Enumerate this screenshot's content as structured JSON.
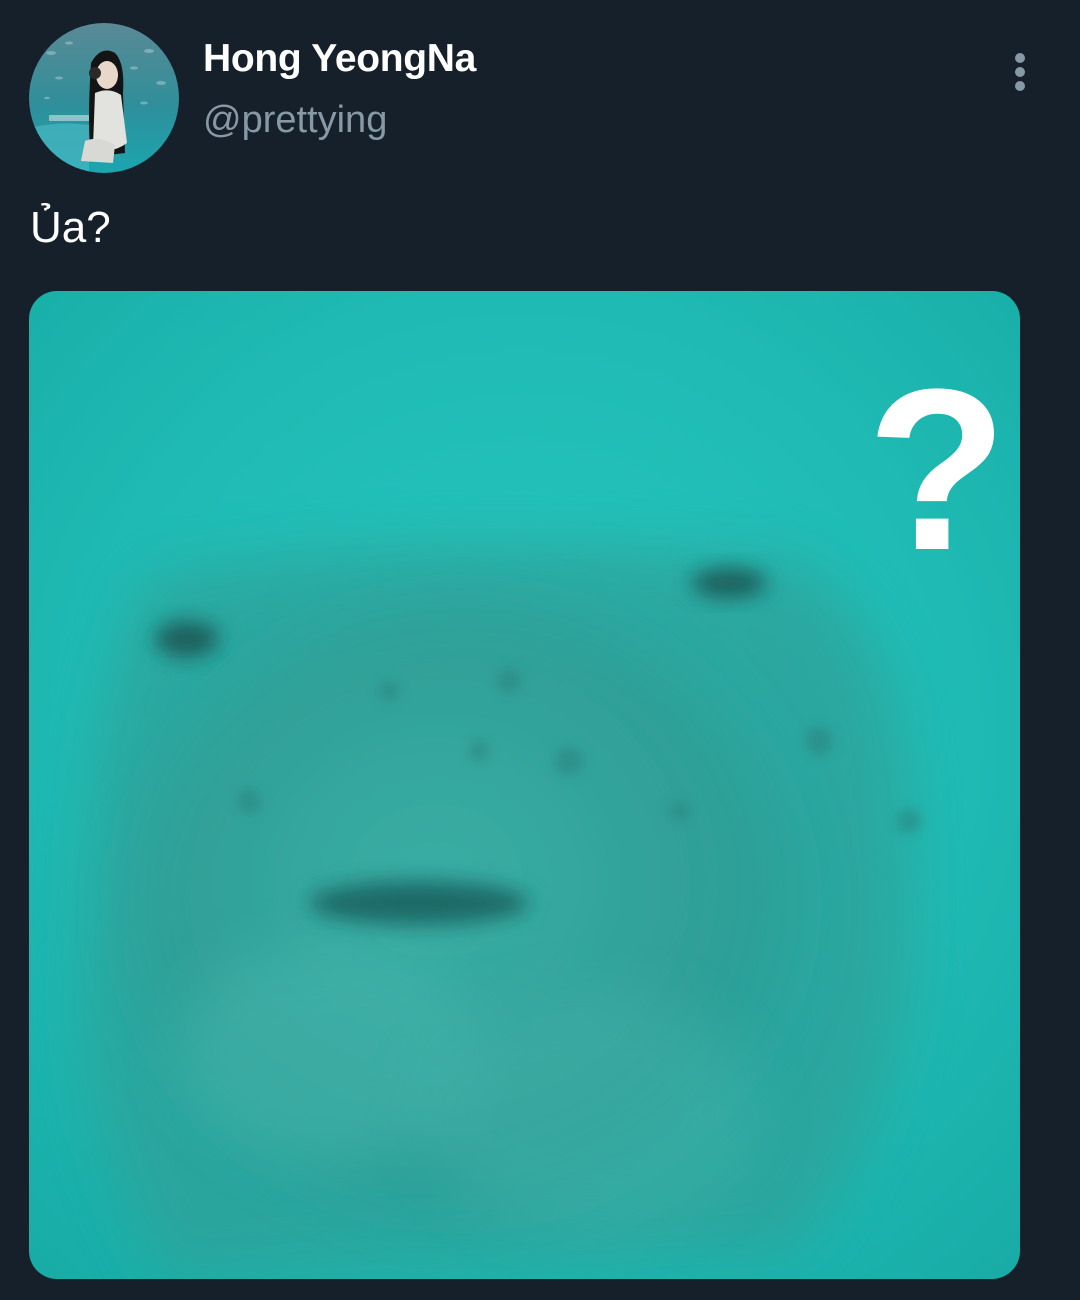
{
  "author": {
    "display_name": "Hong YeongNa",
    "handle": "@prettying",
    "avatar_icon": "profile-photo"
  },
  "tweet": {
    "text": "Ủa?"
  },
  "media": {
    "overlay_text": "?",
    "background_color": "#1ebcb6"
  },
  "actions": {
    "more_icon": "more-vertical-icon"
  },
  "colors": {
    "background": "#15202b",
    "primary_text": "#ffffff",
    "secondary_text": "#8899a6"
  }
}
